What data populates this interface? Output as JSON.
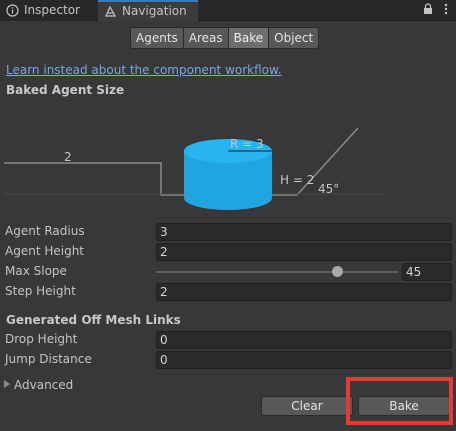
{
  "tabs": {
    "inspector": "Inspector",
    "navigation": "Navigation",
    "lock_icon": "lock-icon",
    "menu_icon": "kebab-menu-icon"
  },
  "segments": {
    "items": [
      "Agents",
      "Areas",
      "Bake",
      "Object"
    ],
    "active": "Bake"
  },
  "link_text": "Learn instead about the component workflow.",
  "baked_agent_size": {
    "title": "Baked Agent Size",
    "diagram": {
      "radius_label": "R = 3",
      "height_label": "H = 2",
      "step_label": "2",
      "slope_label": "45°",
      "cylinder_color": "#1fa6e0"
    },
    "agent_radius": {
      "label": "Agent Radius",
      "value": "3"
    },
    "agent_height": {
      "label": "Agent Height",
      "value": "2"
    },
    "max_slope": {
      "label": "Max Slope",
      "value": "45",
      "min": 0,
      "max": 60
    },
    "step_height": {
      "label": "Step Height",
      "value": "2"
    }
  },
  "off_mesh_links": {
    "title": "Generated Off Mesh Links",
    "drop_height": {
      "label": "Drop Height",
      "value": "0"
    },
    "jump_distance": {
      "label": "Jump Distance",
      "value": "0"
    }
  },
  "advanced_label": "Advanced",
  "buttons": {
    "clear": "Clear",
    "bake": "Bake"
  },
  "colors": {
    "highlight": "#e53935",
    "link": "#7aa6e8",
    "tab_accent": "#3a79bb"
  }
}
